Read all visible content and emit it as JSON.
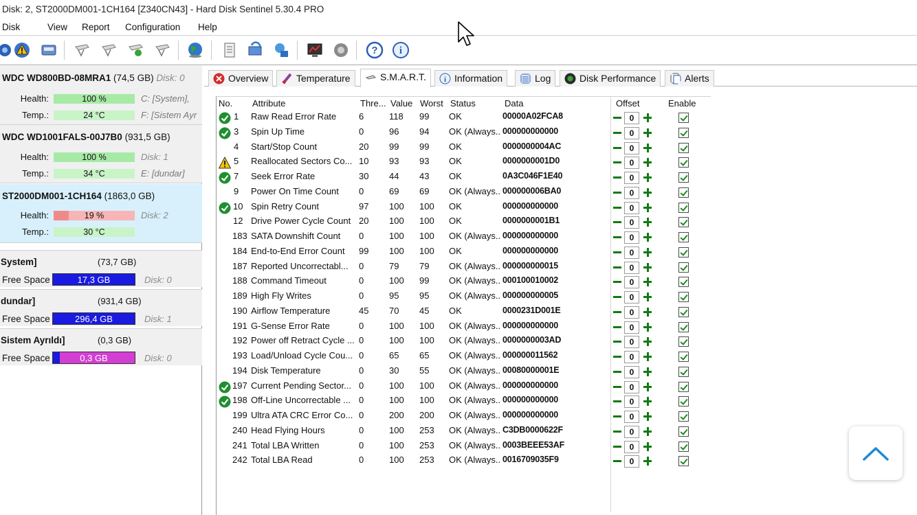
{
  "window": {
    "title": "Disk: 2, ST2000DM001-1CH164 [Z340CN43]  -  Hard Disk Sentinel 5.30.4 PRO"
  },
  "menu": [
    "Disk",
    "View",
    "Report",
    "Configuration",
    "Help"
  ],
  "toolbar_icons": [
    "drive-icon",
    "warning-icon",
    "drive-info-icon",
    "hdd-1-icon",
    "hdd-2-icon",
    "hdd-3-icon",
    "hdd-4-icon",
    "globe-icon",
    "report-icon",
    "refresh-icon",
    "network-icon",
    "chart-icon",
    "settings-icon",
    "help-icon",
    "info-icon"
  ],
  "disks": [
    {
      "model": "WDC WD800BD-08MRA1",
      "size": "(74,5 GB)",
      "disk_label": "Disk: 0",
      "health_label": "Health:",
      "health": "100 %",
      "health_value": 100,
      "health_side": "C: [System],",
      "temp_label": "Temp.:",
      "temp": "24 °C",
      "temp_side": "F: [Sistem Ayr"
    },
    {
      "model": "WDC WD1001FALS-00J7B0",
      "size": "(931,5 GB)",
      "disk_label": "",
      "health_label": "Health:",
      "health": "100 %",
      "health_value": 100,
      "health_side": "Disk: 1",
      "temp_label": "Temp.:",
      "temp": "34 °C",
      "temp_side": "E: [dundar]"
    },
    {
      "model": "ST2000DM001-1CH164",
      "size": "(1863,0 GB)",
      "disk_label": "Disk: 2",
      "health_label": "Health:",
      "health": "19 %",
      "health_value": 19,
      "health_side": "",
      "temp_label": "Temp.:",
      "temp": "30 °C",
      "temp_side": ""
    }
  ],
  "volumes": [
    {
      "name": "System]",
      "size": "(73,7 GB)",
      "free_label": "Free Space",
      "free": "17,3 GB",
      "free_fraction": 0.23,
      "disk": "Disk: 0"
    },
    {
      "name": "dundar]",
      "size": "(931,4 GB)",
      "free_label": "Free Space",
      "free": "296,4 GB",
      "free_fraction": 0.32,
      "disk": "Disk: 1"
    },
    {
      "name": "Sistem Ayrıldı]",
      "size": "(0,3 GB)",
      "free_label": "Free Space",
      "free": "0,3 GB",
      "free_fraction": 1.0,
      "disk": "Disk: 0"
    }
  ],
  "tabs": [
    {
      "label": "Overview",
      "icon": "stop-icon",
      "active": false
    },
    {
      "label": "Temperature",
      "icon": "thermometer-icon",
      "active": false
    },
    {
      "label": "S.M.A.R.T.",
      "icon": "smart-icon",
      "active": true
    },
    {
      "label": "Information",
      "icon": "info-icon",
      "active": false
    },
    {
      "label": "Log",
      "icon": "log-icon",
      "active": false
    },
    {
      "label": "Disk Performance",
      "icon": "performance-icon",
      "active": false
    },
    {
      "label": "Alerts",
      "icon": "alerts-icon",
      "active": false
    }
  ],
  "smart": {
    "columns": {
      "no": "No.",
      "attribute": "Attribute",
      "threshold": "Thre...",
      "value": "Value",
      "worst": "Worst",
      "status": "Status",
      "data": "Data",
      "offset": "Offset",
      "enable": "Enable"
    },
    "rows": [
      {
        "no": "1",
        "attr": "Raw Read Error Rate",
        "thr": "6",
        "val": "118",
        "worst": "99",
        "status": "OK",
        "data": "00000A02FCA8",
        "icon": "check",
        "offset": "0"
      },
      {
        "no": "3",
        "attr": "Spin Up Time",
        "thr": "0",
        "val": "96",
        "worst": "94",
        "status": "OK (Always...",
        "data": "000000000000",
        "icon": "check",
        "offset": "0"
      },
      {
        "no": "4",
        "attr": "Start/Stop Count",
        "thr": "20",
        "val": "99",
        "worst": "99",
        "status": "OK",
        "data": "0000000004AC",
        "icon": "",
        "offset": "0"
      },
      {
        "no": "5",
        "attr": "Reallocated Sectors Co...",
        "thr": "10",
        "val": "93",
        "worst": "93",
        "status": "OK",
        "data": "0000000001D0",
        "icon": "warn",
        "offset": "0"
      },
      {
        "no": "7",
        "attr": "Seek Error Rate",
        "thr": "30",
        "val": "44",
        "worst": "43",
        "status": "OK",
        "data": "0A3C046F1E40",
        "icon": "check",
        "offset": "0"
      },
      {
        "no": "9",
        "attr": "Power On Time Count",
        "thr": "0",
        "val": "69",
        "worst": "69",
        "status": "OK (Always...",
        "data": "000000006BA0",
        "icon": "",
        "offset": "0"
      },
      {
        "no": "10",
        "attr": "Spin Retry Count",
        "thr": "97",
        "val": "100",
        "worst": "100",
        "status": "OK",
        "data": "000000000000",
        "icon": "check",
        "offset": "0"
      },
      {
        "no": "12",
        "attr": "Drive Power Cycle Count",
        "thr": "20",
        "val": "100",
        "worst": "100",
        "status": "OK",
        "data": "0000000001B1",
        "icon": "",
        "offset": "0"
      },
      {
        "no": "183",
        "attr": "SATA Downshift Count",
        "thr": "0",
        "val": "100",
        "worst": "100",
        "status": "OK (Always...",
        "data": "000000000000",
        "icon": "",
        "offset": "0"
      },
      {
        "no": "184",
        "attr": "End-to-End Error Count",
        "thr": "99",
        "val": "100",
        "worst": "100",
        "status": "OK",
        "data": "000000000000",
        "icon": "",
        "offset": "0"
      },
      {
        "no": "187",
        "attr": "Reported Uncorrectabl...",
        "thr": "0",
        "val": "79",
        "worst": "79",
        "status": "OK (Always...",
        "data": "000000000015",
        "icon": "",
        "offset": "0"
      },
      {
        "no": "188",
        "attr": "Command Timeout",
        "thr": "0",
        "val": "100",
        "worst": "99",
        "status": "OK (Always...",
        "data": "000100010002",
        "icon": "",
        "offset": "0"
      },
      {
        "no": "189",
        "attr": "High Fly Writes",
        "thr": "0",
        "val": "95",
        "worst": "95",
        "status": "OK (Always...",
        "data": "000000000005",
        "icon": "",
        "offset": "0"
      },
      {
        "no": "190",
        "attr": "Airflow Temperature",
        "thr": "45",
        "val": "70",
        "worst": "45",
        "status": "OK",
        "data": "0000231D001E",
        "icon": "",
        "offset": "0"
      },
      {
        "no": "191",
        "attr": "G-Sense Error Rate",
        "thr": "0",
        "val": "100",
        "worst": "100",
        "status": "OK (Always...",
        "data": "000000000000",
        "icon": "",
        "offset": "0"
      },
      {
        "no": "192",
        "attr": "Power off Retract Cycle ...",
        "thr": "0",
        "val": "100",
        "worst": "100",
        "status": "OK (Always...",
        "data": "0000000003AD",
        "icon": "",
        "offset": "0"
      },
      {
        "no": "193",
        "attr": "Load/Unload Cycle Cou...",
        "thr": "0",
        "val": "65",
        "worst": "65",
        "status": "OK (Always...",
        "data": "000000011562",
        "icon": "",
        "offset": "0"
      },
      {
        "no": "194",
        "attr": "Disk Temperature",
        "thr": "0",
        "val": "30",
        "worst": "55",
        "status": "OK (Always...",
        "data": "00080000001E",
        "icon": "",
        "offset": "0"
      },
      {
        "no": "197",
        "attr": "Current Pending Sector...",
        "thr": "0",
        "val": "100",
        "worst": "100",
        "status": "OK (Always...",
        "data": "000000000000",
        "icon": "check",
        "offset": "0"
      },
      {
        "no": "198",
        "attr": "Off-Line Uncorrectable ...",
        "thr": "0",
        "val": "100",
        "worst": "100",
        "status": "OK (Always...",
        "data": "000000000000",
        "icon": "check",
        "offset": "0"
      },
      {
        "no": "199",
        "attr": "Ultra ATA CRC Error Co...",
        "thr": "0",
        "val": "200",
        "worst": "200",
        "status": "OK (Always...",
        "data": "000000000000",
        "icon": "",
        "offset": "0"
      },
      {
        "no": "240",
        "attr": "Head Flying Hours",
        "thr": "0",
        "val": "100",
        "worst": "253",
        "status": "OK (Always...",
        "data": "C3DB0000622F",
        "icon": "",
        "offset": "0"
      },
      {
        "no": "241",
        "attr": "Total LBA Written",
        "thr": "0",
        "val": "100",
        "worst": "253",
        "status": "OK (Always...",
        "data": "0003BEEE53AF",
        "icon": "",
        "offset": "0"
      },
      {
        "no": "242",
        "attr": "Total LBA Read",
        "thr": "0",
        "val": "100",
        "worst": "253",
        "status": "OK (Always...",
        "data": "0016709035F9",
        "icon": "",
        "offset": "0"
      }
    ]
  },
  "colors": {
    "health_green": "#a6eaa6",
    "health_red": "#f7b5b5",
    "free_blue": "#1a1ae0",
    "free_magenta": "#d33fd3",
    "selected_disk": "#d8f0fb",
    "ok_green": "#1f8f2f",
    "warn_yellow": "#f5c400"
  }
}
